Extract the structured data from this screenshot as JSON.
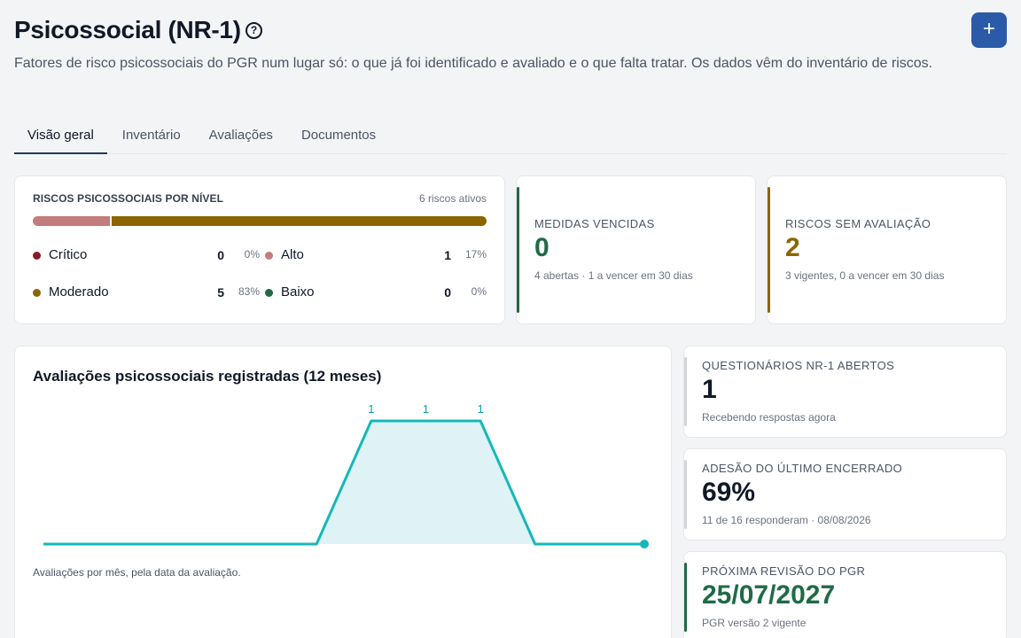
{
  "header": {
    "title": "Psicossocial (NR-1)",
    "help_icon": "?",
    "add_icon": "+",
    "subtitle": "Fatores de risco psicossociais do PGR num lugar só: o que já foi identificado e avaliado e o que falta tratar. Os dados vêm do inventário de riscos."
  },
  "tabs": [
    {
      "label": "Visão geral",
      "active": true
    },
    {
      "label": "Inventário",
      "active": false
    },
    {
      "label": "Avaliações",
      "active": false
    },
    {
      "label": "Documentos",
      "active": false
    }
  ],
  "levels": {
    "title": "RISCOS PSICOSSOCIAIS POR NÍVEL",
    "count": "6 riscos ativos",
    "items": [
      {
        "label": "Crítico",
        "count": "0",
        "pct": "0%",
        "color": "#8b1a2a"
      },
      {
        "label": "Alto",
        "count": "1",
        "pct": "17%",
        "color": "#c47b7b"
      },
      {
        "label": "Moderado",
        "count": "5",
        "pct": "83%",
        "color": "#8a6500"
      },
      {
        "label": "Baixo",
        "count": "0",
        "pct": "0%",
        "color": "#1f6b46"
      }
    ],
    "bar_fractions": [
      0.17,
      0.83
    ]
  },
  "stats": {
    "overdue": {
      "label": "MEDIDAS VENCIDAS",
      "value": "0",
      "note": "4 abertas · 1 a vencer em 30 dias",
      "color": "#1f6b46"
    },
    "unassessed": {
      "label": "RISCOS SEM AVALIAÇÃO",
      "value": "2",
      "note": "3 vigentes, 0 a vencer em 30 dias",
      "color": "#8a6500"
    },
    "questionnaires": {
      "label": "QUESTIONÁRIOS NR-1 ABERTOS",
      "value": "1",
      "note": "Recebendo respostas agora",
      "color": "#d1d5db"
    },
    "adhesion": {
      "label": "ADESÃO DO ÚLTIMO ENCERRADO",
      "value": "69%",
      "note": "11 de 16 responderam · 08/08/2026",
      "color": "#d1d5db"
    },
    "review": {
      "label": "PRÓXIMA REVISÃO DO PGR",
      "value": "25/07/2027",
      "note": "PGR versão 2 vigente",
      "color": "#1f6b46"
    }
  },
  "chart": {
    "title": "Avaliações psicossociais registradas (12 meses)",
    "note": "Avaliações por mês, pela data da avaliação.",
    "line_color": "#14b8b8",
    "fill_color": "#dff3f7"
  },
  "chart_data": {
    "type": "area",
    "title": "Avaliações psicossociais registradas (12 meses)",
    "values": [
      0,
      0,
      0,
      0,
      0,
      0,
      1,
      1,
      1,
      0,
      0,
      0
    ],
    "data_labels": [
      "",
      "",
      "",
      "",
      "",
      "",
      "1",
      "1",
      "1",
      "",
      "",
      ""
    ],
    "ylim": [
      0,
      1
    ],
    "grid": false
  }
}
